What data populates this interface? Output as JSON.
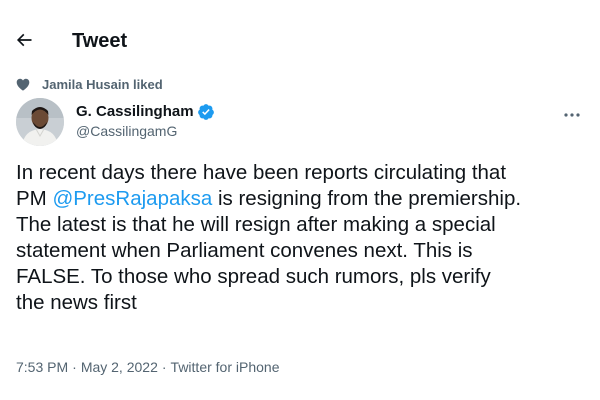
{
  "header": {
    "back_icon": "arrow-left-icon",
    "title": "Tweet"
  },
  "social_context": {
    "icon": "heart-icon",
    "text": "Jamila Husain liked"
  },
  "author": {
    "name": "G. Cassilingham",
    "handle": "@CassilingamG",
    "verified_icon": "verified-badge-icon",
    "more_icon": "more-dots-icon",
    "verified_color": "#1d9bf0"
  },
  "tweet": {
    "lines": [
      {
        "before": "In recent days there have been reports circulating that",
        "mention": "",
        "after": ""
      },
      {
        "before": "PM ",
        "mention": "@PresRajapaksa",
        "after": " is resigning from the premiership."
      },
      {
        "before": "The latest is that he will resign after making a special",
        "mention": "",
        "after": ""
      },
      {
        "before": "statement when Parliament convenes next. This is",
        "mention": "",
        "after": ""
      },
      {
        "before": "FALSE. To those who spread such rumors, pls verify",
        "mention": "",
        "after": ""
      },
      {
        "before": "the news first",
        "mention": "",
        "after": ""
      }
    ],
    "mention_color": "#1d9bf0"
  },
  "meta": {
    "time": "7:53 PM",
    "separator": "·",
    "date": "May 2, 2022",
    "source": "Twitter for iPhone"
  }
}
